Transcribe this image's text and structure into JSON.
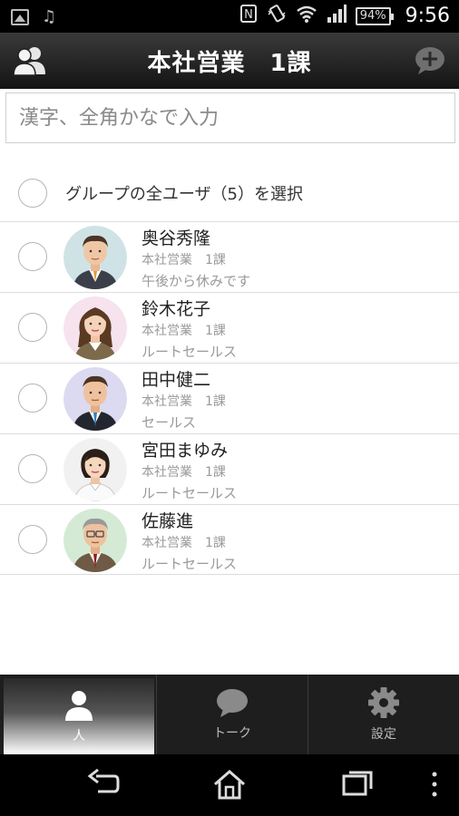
{
  "status_bar": {
    "battery": "94%",
    "time": "9:56"
  },
  "header": {
    "title": "本社営業　1課"
  },
  "search": {
    "placeholder": "漢字、全角かなで入力"
  },
  "select_all": {
    "label": "グループの全ユーザ（5）を選択"
  },
  "users": [
    {
      "name": "奥谷秀隆",
      "dept": "本社営業　1課",
      "status": "午後から休みです",
      "avatar_bg": "#cfe3e6"
    },
    {
      "name": "鈴木花子",
      "dept": "本社営業　1課",
      "status": "ルートセールス",
      "avatar_bg": "#f6e3ee"
    },
    {
      "name": "田中健二",
      "dept": "本社営業　1課",
      "status": "セールス",
      "avatar_bg": "#dcdaf0"
    },
    {
      "name": "宮田まゆみ",
      "dept": "本社営業　1課",
      "status": "ルートセールス",
      "avatar_bg": "#f1f1f1"
    },
    {
      "name": "佐藤進",
      "dept": "本社営業　1課",
      "status": "ルートセールス",
      "avatar_bg": "#d5ead5"
    }
  ],
  "tabs": [
    {
      "label": "人",
      "icon": "person-icon",
      "active": true
    },
    {
      "label": "トーク",
      "icon": "chat-bubble-icon",
      "active": false
    },
    {
      "label": "設定",
      "icon": "gear-icon",
      "active": false
    }
  ],
  "colors": {
    "header_bg": "#1e1e1e",
    "tab_active": "#ffffff"
  }
}
